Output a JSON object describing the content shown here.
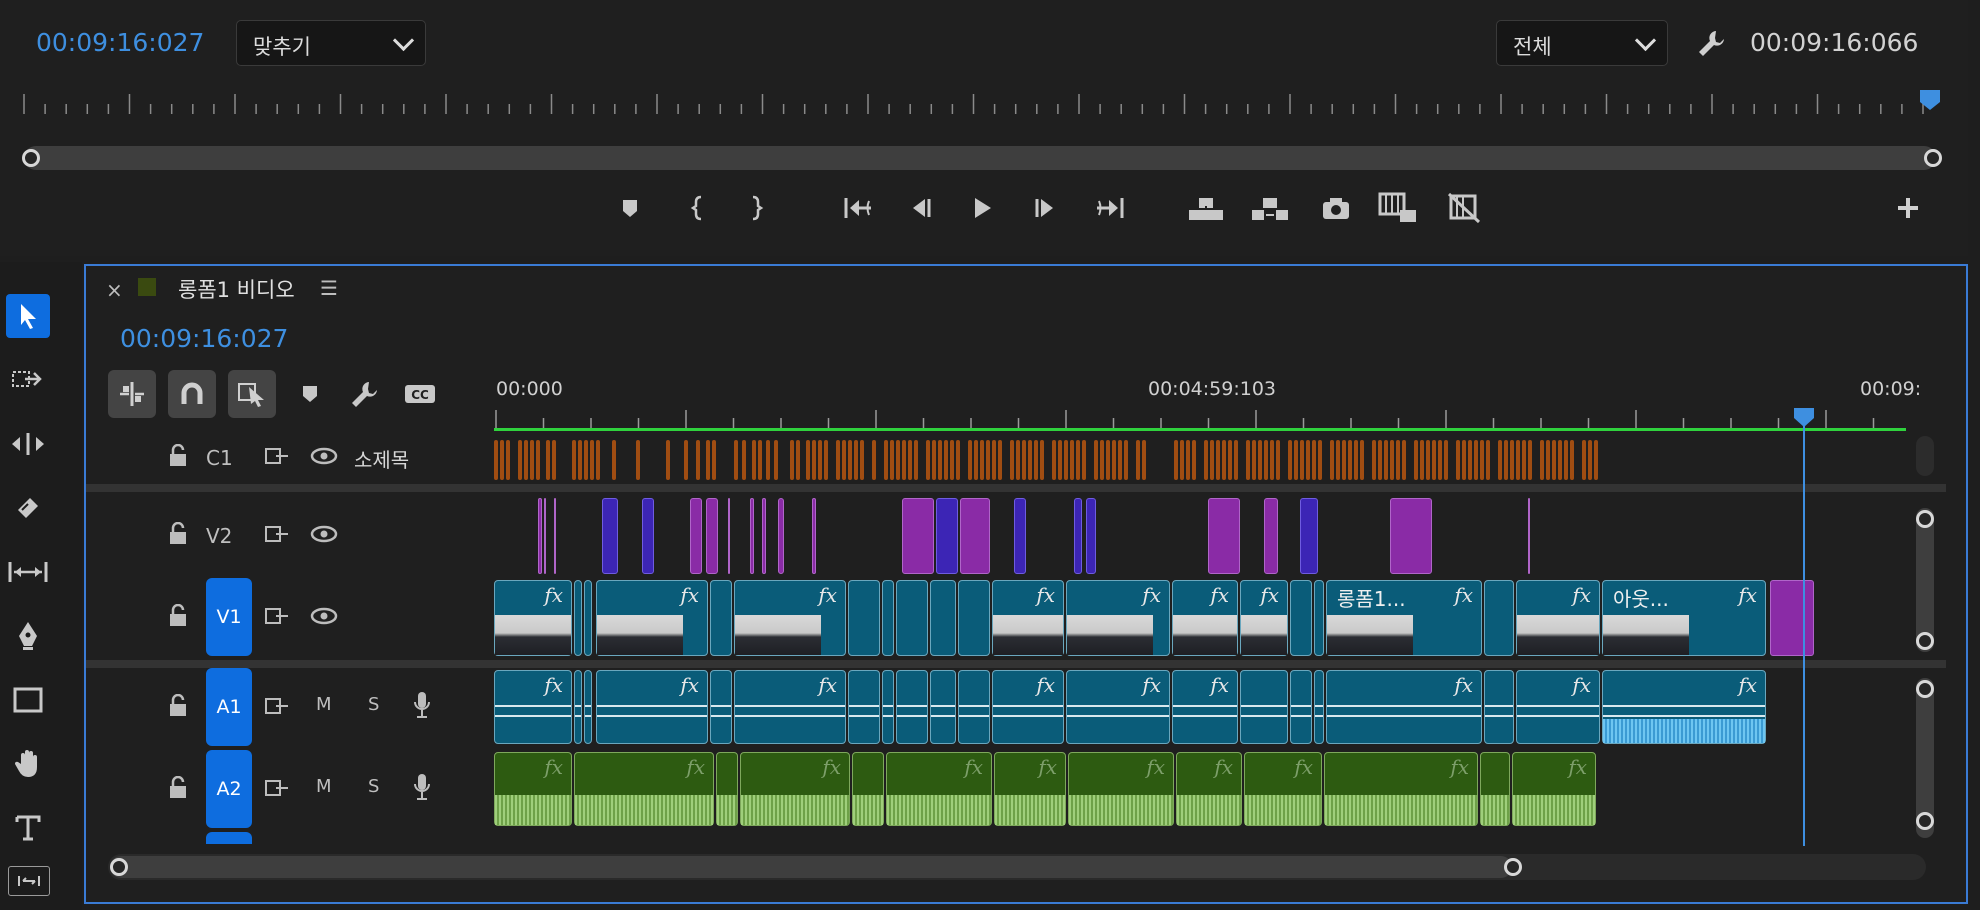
{
  "monitor": {
    "playhead_timecode": "00:09:16:027",
    "fit_dropdown": "맞추기",
    "quality_dropdown": "전체",
    "duration_timecode": "00:09:16:066",
    "icons": [
      "add-marker-icon",
      "mark-in-icon",
      "mark-out-icon",
      "go-to-in-icon",
      "step-back-icon",
      "play-icon",
      "step-forward-icon",
      "go-to-out-icon",
      "lift-icon",
      "extract-icon",
      "export-frame-icon",
      "insert-icon",
      "comparison-icon",
      "add-button-icon"
    ]
  },
  "tools": [
    "selection-tool",
    "track-select-tool",
    "ripple-edit-tool",
    "razor-tool",
    "slip-tool",
    "pen-tool",
    "rectangle-tool",
    "hand-tool",
    "type-tool",
    "remix-tool"
  ],
  "timeline": {
    "close_glyph": "×",
    "sequence_name": "롱폼1 비디오",
    "menu_glyph": "☰",
    "playhead_timecode": "00:09:16:027",
    "ruler_labels": [
      "00:000",
      "00:04:59:103",
      "00:09:"
    ],
    "tracks": [
      {
        "id": "C1",
        "name": "소제목"
      },
      {
        "id": "V2",
        "name": ""
      },
      {
        "id": "V1",
        "name": ""
      },
      {
        "id": "A1",
        "name": "",
        "mute": "M",
        "solo": "S"
      },
      {
        "id": "A2",
        "name": "",
        "mute": "M",
        "solo": "S"
      }
    ],
    "clip_labels": {
      "longform": "롱폼1...",
      "out": "아웃..."
    },
    "fx_glyph": "fx",
    "colors": {
      "accent": "#3e8fe0",
      "video_clip": "#0a5c79",
      "audio_clip_a2": "#2d5b11",
      "caption_clip": "#a04d12",
      "graphics_clip": "#8a2ba6",
      "work_area": "#2fd23d"
    }
  }
}
